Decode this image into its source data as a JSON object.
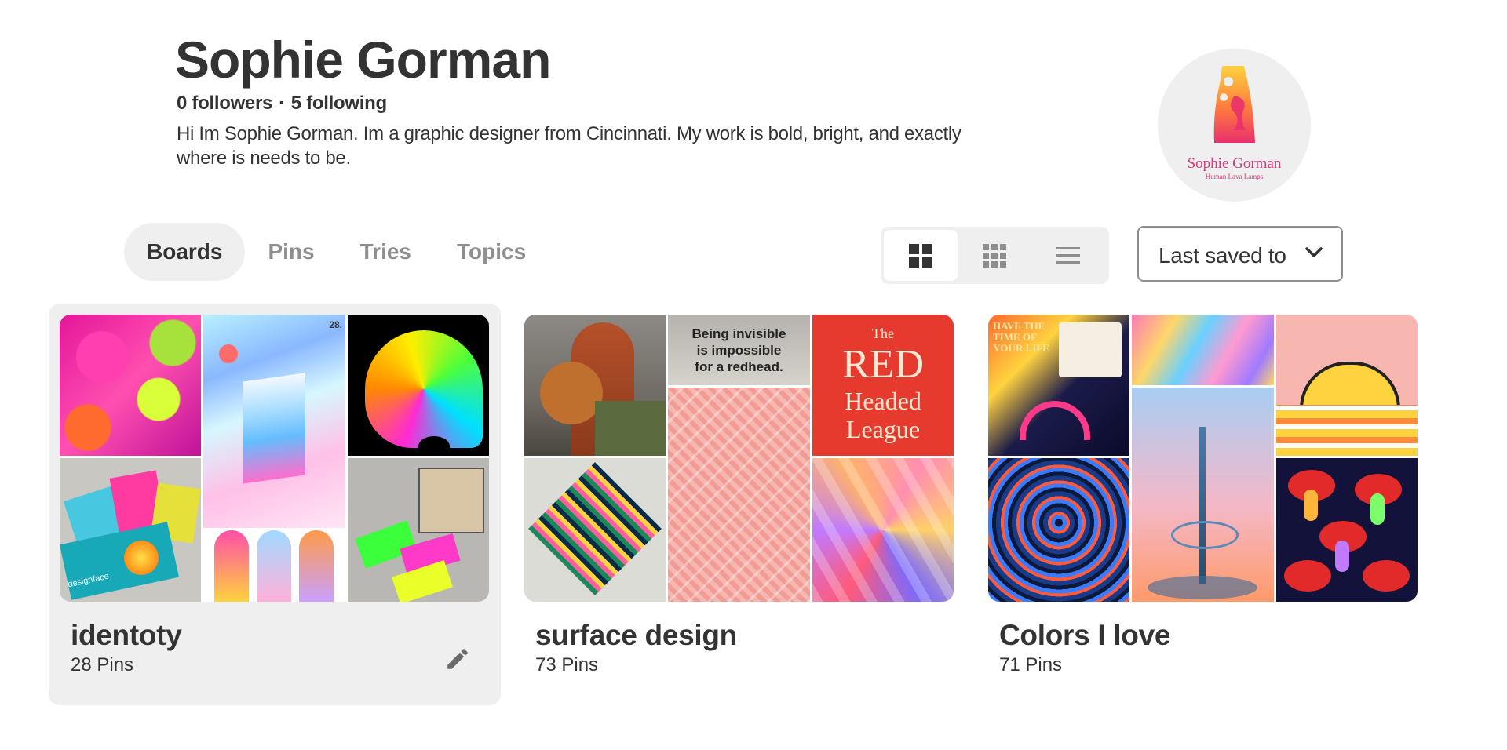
{
  "profile": {
    "name": "Sophie Gorman",
    "followers": "0 followers",
    "separator": "·",
    "following": "5 following",
    "bio": "Hi Im Sophie Gorman. Im a graphic designer from Cincinnati. My work is bold, bright, and exactly where is needs to be.",
    "avatar": {
      "name": "Sophie Gorman",
      "tagline": "Human Lava Lamps",
      "accent": "#d8397a"
    }
  },
  "tabs": [
    {
      "label": "Boards",
      "active": true
    },
    {
      "label": "Pins",
      "active": false
    },
    {
      "label": "Tries",
      "active": false
    },
    {
      "label": "Topics",
      "active": false
    }
  ],
  "view_options": [
    {
      "icon": "large-grid-icon",
      "active": true
    },
    {
      "icon": "small-grid-icon",
      "active": false
    },
    {
      "icon": "list-icon",
      "active": false
    }
  ],
  "sort": {
    "label": "Last saved to",
    "icon": "chevron-down-icon"
  },
  "boards": [
    {
      "title": "identoty",
      "count": "28 Pins",
      "hovered": true,
      "edit_icon": "pencil-icon"
    },
    {
      "title": "surface design",
      "count": "73 Pins",
      "hovered": false
    },
    {
      "title": "Colors I love",
      "count": "71 Pins",
      "hovered": false
    }
  ],
  "board_images": {
    "surface": {
      "quote": "Being invisible is impossible for a redhead.",
      "poster_line1": "The",
      "poster_line2": "RED",
      "poster_line3": "Headed",
      "poster_line4": "League"
    },
    "colors": {
      "collage_text": "HAVE THE TIME OF YOUR LIFE"
    },
    "identity": {
      "card_text": "designface",
      "poster_number": "28."
    }
  },
  "colors": {
    "text_primary": "#333333",
    "text_secondary": "#8e8e8e",
    "surface_gray": "#efefef",
    "background": "#ffffff"
  }
}
